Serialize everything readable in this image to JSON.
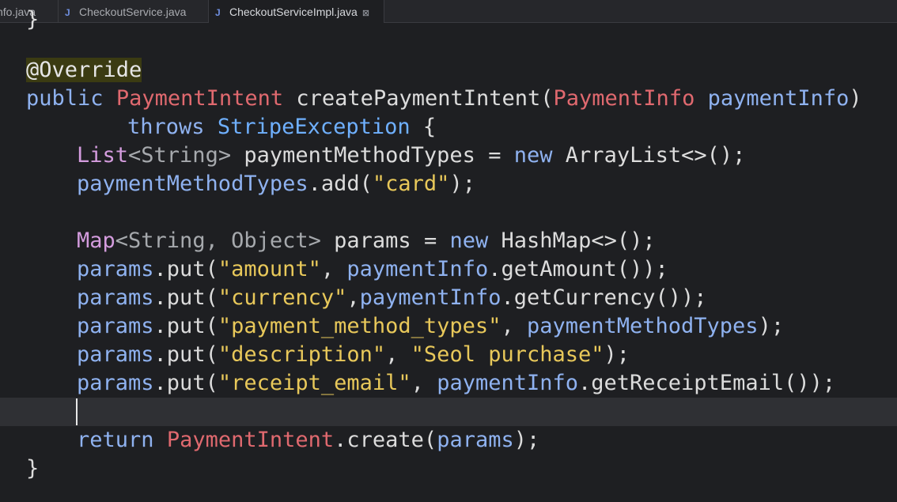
{
  "tabs": [
    {
      "label": "nfo.java",
      "icon": "java-file-icon"
    },
    {
      "label": "CheckoutService.java",
      "icon": "java-file-icon"
    },
    {
      "label": "CheckoutServiceImpl.java",
      "icon": "java-file-icon",
      "active": true,
      "close": "⊠"
    }
  ],
  "code": {
    "top_brace": "}",
    "annotation": "@Override",
    "l2_public": "public",
    "l2_type": "PaymentIntent",
    "l2_method": "createPaymentIntent(",
    "l2_ptype": "PaymentInfo",
    "l2_param": "paymentInfo",
    "l2_close": ")",
    "l3_throws": "throws",
    "l3_exc": "StripeException",
    "l3_brace": "{",
    "l4_list": "List",
    "l4_generic": "<String>",
    "l4_var": "paymentMethodTypes",
    "l4_eq": "=",
    "l4_new": "new",
    "l4_rest": "ArrayList<>();",
    "l5_var": "paymentMethodTypes",
    "l5_call": ".add(",
    "l5_str": "\"card\"",
    "l5_end": ");",
    "l6_map": "Map",
    "l6_generic": "<String, Object>",
    "l6_var": "params",
    "l6_eq": "=",
    "l6_new": "new",
    "l6_rest": "HashMap<>();",
    "put_lines": [
      {
        "obj": "params",
        "call": ".put(",
        "key": "\"amount\"",
        "sep": ", ",
        "arg": "paymentInfo",
        "argcall": ".getAmount());"
      },
      {
        "obj": "params",
        "call": ".put(",
        "key": "\"currency\"",
        "sep": ",",
        "arg": "paymentInfo",
        "argcall": ".getCurrency());"
      },
      {
        "obj": "params",
        "call": ".put(",
        "key": "\"payment_method_types\"",
        "sep": ", ",
        "arg": "paymentMethodTypes",
        "argcall": ");"
      },
      {
        "obj": "params",
        "call": ".put(",
        "key": "\"description\"",
        "sep": ", ",
        "arg": "\"Seol purchase\"",
        "argcall": ");"
      },
      {
        "obj": "params",
        "call": ".put(",
        "key": "\"receipt_email\"",
        "sep": ", ",
        "arg": "paymentInfo",
        "argcall": ".getReceiptEmail());"
      }
    ],
    "ret_kw": "return",
    "ret_type": "PaymentIntent",
    "ret_call": ".create(",
    "ret_arg": "params",
    "ret_end": ");",
    "close_brace": "}"
  }
}
